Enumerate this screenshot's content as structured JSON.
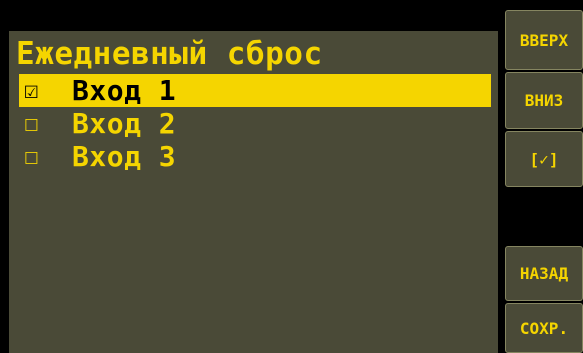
{
  "screen": {
    "title": "Ежедневный сброс"
  },
  "inputs": [
    {
      "checkbox": "☑",
      "label": "Вход 1",
      "checked": true,
      "selected": true
    },
    {
      "checkbox": "☐",
      "label": "Вход 2",
      "checked": false,
      "selected": false
    },
    {
      "checkbox": "☐",
      "label": "Вход 3",
      "checked": false,
      "selected": false
    }
  ],
  "softkeys": {
    "up": "ВВЕРХ",
    "down": "ВНИЗ",
    "toggle": "[✓]",
    "blank": "",
    "back": "НАЗАД",
    "save": "СОХР."
  },
  "colors": {
    "background": "#000000",
    "panel": "#4a4a37",
    "accent": "#f5d500",
    "selected_text": "#000000",
    "button_border": "#858560"
  }
}
